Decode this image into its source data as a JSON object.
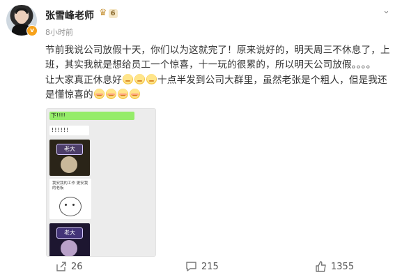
{
  "user": {
    "name": "张雪峰老师",
    "vip_level": "6",
    "verified_badge": "v",
    "time": "8小时前"
  },
  "post": {
    "line1": "节前我说公司放假十天，你们以为这就完了！原来说好的，明天周三不休息了，上",
    "line2": "班，其实我就是想给员工一个惊喜，十一玩的很累的，所以明天公司放假。。。。",
    "line3a": "让大家真正休息好",
    "line3b": "十点半发到公司大群里，虽然老张是个粗人，但是我还",
    "line4": "是懂惊喜的"
  },
  "screenshot": {
    "green_text": "下!!!!",
    "white_text": "!!!!!!",
    "meme_label": "老大",
    "card_text": "我安我的工作 更安我的老板"
  },
  "actions": {
    "share_count": "26",
    "comment_count": "215",
    "like_count": "1355"
  },
  "icons": [
    "share-icon",
    "comment-icon",
    "like-icon",
    "more-icon"
  ]
}
